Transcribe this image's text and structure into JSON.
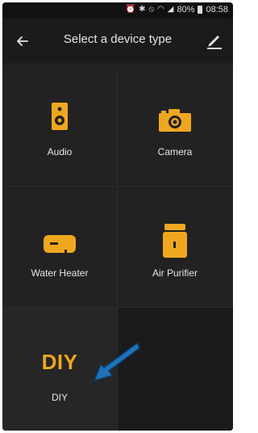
{
  "status_bar": {
    "icons": [
      "alarm-icon",
      "bluetooth-icon",
      "mute-icon",
      "wifi-icon",
      "signal-icon",
      "battery-icon"
    ],
    "battery": "80%",
    "time": "08:58"
  },
  "header": {
    "title": "Select a device type"
  },
  "devices": [
    {
      "label": "Audio",
      "icon": "speaker-icon"
    },
    {
      "label": "Camera",
      "icon": "camera-icon"
    },
    {
      "label": "Water Heater",
      "icon": "water-heater-icon"
    },
    {
      "label": "Air Purifier",
      "icon": "air-purifier-icon"
    },
    {
      "label": "DIY",
      "icon_text": "DIY"
    }
  ],
  "colors": {
    "accent": "#f0a720",
    "background": "#1f1f1f",
    "annotation_arrow": "#1e73b8"
  }
}
